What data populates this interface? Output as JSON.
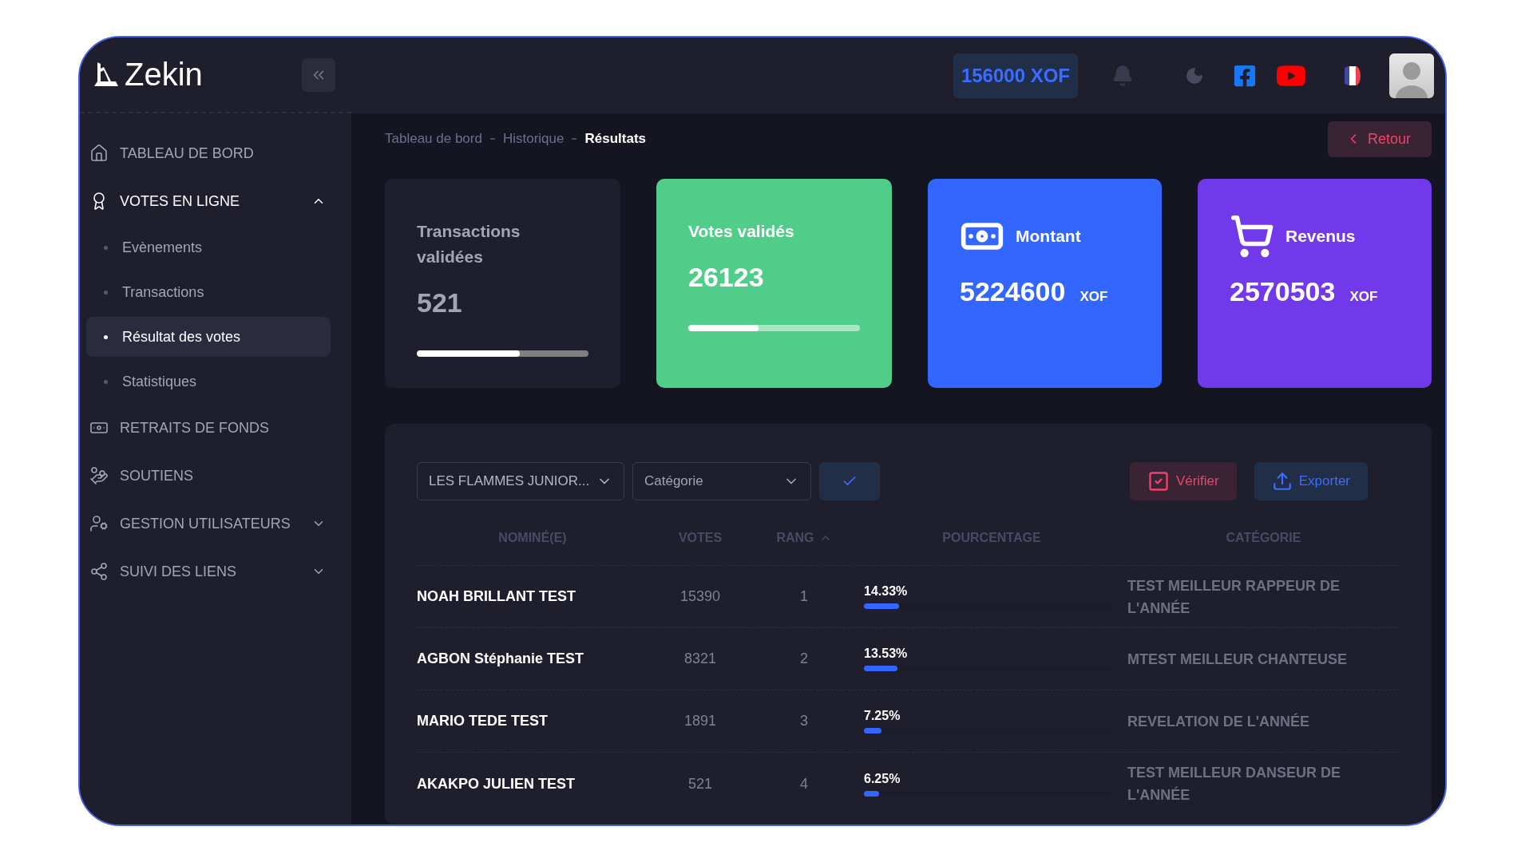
{
  "brand": {
    "name": "Zekin"
  },
  "header": {
    "balance": "156000 XOF"
  },
  "sidebar": {
    "items": [
      {
        "kind": "link",
        "label": "TABLEAU DE BORD",
        "selected": false
      },
      {
        "kind": "group",
        "label": "VOTES EN LIGNE",
        "selected": true,
        "expanded": true,
        "children": [
          {
            "label": "Evènements",
            "selected": false
          },
          {
            "label": "Transactions",
            "selected": false
          },
          {
            "label": "Résultat des votes",
            "selected": true
          },
          {
            "label": "Statistiques",
            "selected": false
          }
        ]
      },
      {
        "kind": "link",
        "label": "RETRAITS DE FONDS",
        "selected": false
      },
      {
        "kind": "link",
        "label": "SOUTIENS",
        "selected": false
      },
      {
        "kind": "group",
        "label": "GESTION UTILISATEURS",
        "selected": false,
        "expanded": false
      },
      {
        "kind": "group",
        "label": "SUIVI DES LIENS",
        "selected": false,
        "expanded": false
      }
    ]
  },
  "breadcrumb": [
    {
      "label": "Tableau de bord",
      "selected": false
    },
    {
      "label": "Historique",
      "selected": false
    },
    {
      "label": "Résultats",
      "selected": true
    }
  ],
  "back_button": "Retour",
  "stats": [
    {
      "kind": "progress",
      "title": "Transactions validées",
      "value": "521",
      "level": 0.6,
      "color": "#1e1e2d"
    },
    {
      "kind": "progress",
      "title": "Votes validés",
      "value": "26123",
      "level": 0.41,
      "color": "#50cd89"
    },
    {
      "kind": "amount",
      "title": "Montant",
      "value": "5224600",
      "unit": "XOF",
      "color": "#3366ff"
    },
    {
      "kind": "amount",
      "title": "Revenus",
      "value": "2570503",
      "unit": "XOF",
      "color": "#7239ea"
    }
  ],
  "filters": {
    "event": {
      "value": "LES FLAMMES JUNIOR..."
    },
    "category": {
      "placeholder": "Catégorie"
    }
  },
  "actions": [
    "Vérifier",
    "Exporter"
  ],
  "table": {
    "columns": [
      {
        "label": "NOMINÉ(E)",
        "sorted": false
      },
      {
        "label": "VOTES",
        "sorted": false
      },
      {
        "label": "RANG",
        "sorted": true
      },
      {
        "label": "POURCENTAGE",
        "sorted": false
      },
      {
        "label": "CATÉGORIE",
        "sorted": false
      }
    ],
    "rows": [
      {
        "name": "NOAH BRILLANT TEST",
        "votes": "15390",
        "rank": "1",
        "percentage": "14.33%",
        "level": 0.1433,
        "category": "TEST MEILLEUR RAPPEUR DE L'ANNÉE"
      },
      {
        "name": "AGBON Stéphanie TEST",
        "votes": "8321",
        "rank": "2",
        "percentage": "13.53%",
        "level": 0.1353,
        "category": "MTEST MEILLEUR CHANTEUSE"
      },
      {
        "name": "MARIO TEDE TEST",
        "votes": "1891",
        "rank": "3",
        "percentage": "7.25%",
        "level": 0.0725,
        "category": "REVELATION DE L'ANNÉE"
      },
      {
        "name": "AKAKPO JULIEN TEST",
        "votes": "521",
        "rank": "4",
        "percentage": "6.25%",
        "level": 0.0625,
        "category": "TEST MEILLEUR DANSEUR DE L'ANNÉE"
      }
    ]
  }
}
